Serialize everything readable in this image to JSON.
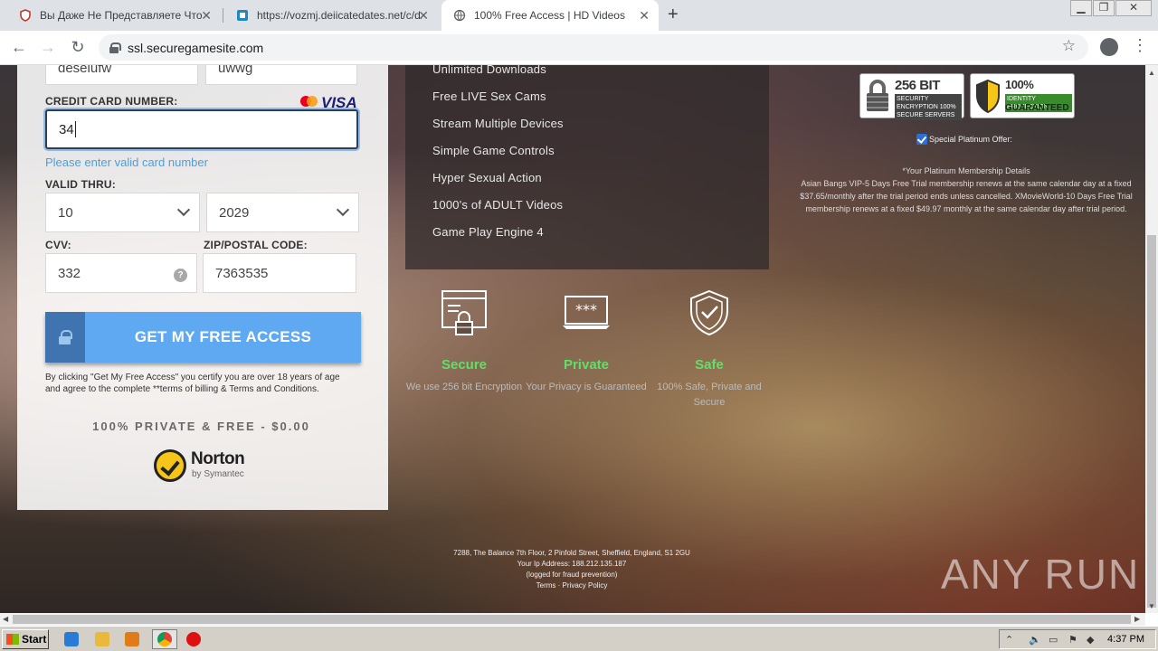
{
  "browser": {
    "tabs": [
      {
        "title": "Вы Даже Не Представляете Что Мо",
        "favicon": "shield-icon",
        "active": false
      },
      {
        "title": "https://vozmj.deiicatedates.net/c/dz",
        "favicon": "site-icon",
        "active": false
      },
      {
        "title": "100% Free Access | HD Videos",
        "favicon": "globe-icon",
        "active": true
      }
    ],
    "new_tab": "+",
    "url": "ssl.securegamesite.com"
  },
  "form": {
    "name_first_value": "deselufw",
    "name_last_value": "uwwg",
    "cc_label": "CREDIT CARD NUMBER:",
    "cc_brand": "VISA",
    "cc_value": "34",
    "cc_error": "Please enter valid card number",
    "valid_thru_label": "VALID THRU:",
    "month": "10",
    "year": "2029",
    "cvv_label": "CVV:",
    "cvv_value": "332",
    "cvv_help": "?",
    "zip_label": "ZIP/POSTAL CODE:",
    "zip_value": "7363535",
    "cta": "GET MY FREE ACCESS",
    "terms": "By clicking \"Get My Free Access\" you certify you are over 18 years of age and agree to the complete **terms of billing & Terms and Conditions.",
    "private_free": "100% PRIVATE & FREE - $0.00",
    "norton_name": "Norton",
    "norton_by": "by Symantec"
  },
  "features": [
    "Unlimited Downloads",
    "Free LIVE Sex Cams",
    "Stream Multiple Devices",
    "Simple Game Controls",
    "Hyper Sexual Action",
    "1000's of ADULT Videos",
    "Game Play Engine 4"
  ],
  "badges": {
    "ssl_title": "256 BIT SSL",
    "ssl_sub": "SECURITY ENCRYPTION 100% SECURE SERVERS",
    "privacy_title": "100% PRIVACY",
    "privacy_sub": "IDENTITY PROTECTION",
    "privacy_sub2": "GUARANTEED"
  },
  "special_offer": {
    "label": "Special Platinum Offer:",
    "checked": true
  },
  "disclaimer": "*Your Platinum Membership Details\nAsian Bangs VIP-5 Days Free Trial membership renews at the same calendar day at a fixed $37.65/monthly after the trial period ends unless cancelled. XMovieWorld-10 Days Free Trial membership renews at a fixed $49.97 monthly at the same calendar day after trial period.",
  "trust": [
    {
      "name": "Secure",
      "desc": "We use 256 bit Encryption",
      "icon": "browser-lock-icon"
    },
    {
      "name": "Private",
      "desc": "Your Privacy is Guaranteed",
      "icon": "password-screen-icon"
    },
    {
      "name": "Safe",
      "desc": "100% Safe, Private and Secure",
      "icon": "shield-check-icon"
    }
  ],
  "footer": {
    "address": "7288, The Balance 7th Floor, 2 Pinfold Street, Sheffield, England, S1 2GU",
    "ip": "Your Ip Address: 188.212.135.187",
    "logged": "(logged for fraud prevention)",
    "links": "Terms · Privacy Policy"
  },
  "watermark": "ANY RUN",
  "taskbar": {
    "start": "Start",
    "clock": "4:37 PM"
  },
  "colors": {
    "cta": "#5ea9f1",
    "trust_green": "#5fe069",
    "error_blue": "#4a9fe0"
  }
}
